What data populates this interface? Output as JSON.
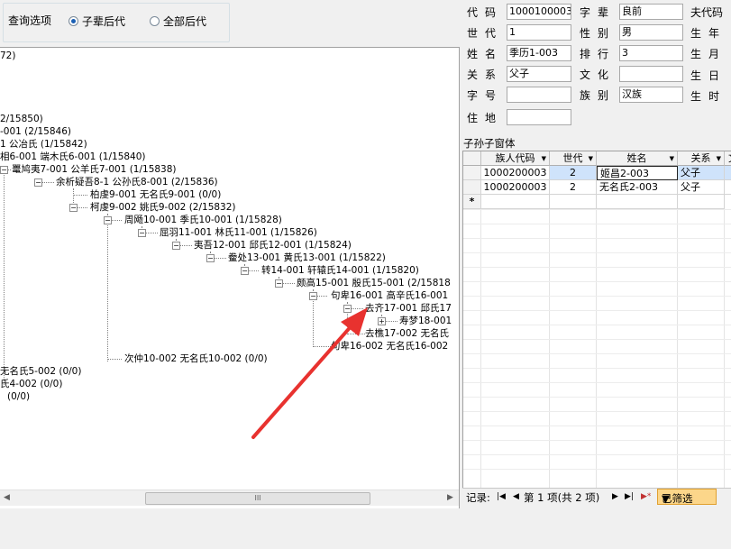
{
  "query_options": {
    "title": "查询选项",
    "radios": [
      {
        "label": "子辈后代",
        "checked": true
      },
      {
        "label": "全部后代",
        "checked": false
      }
    ]
  },
  "tree": {
    "lines": [
      "72)",
      "2/15850)",
      "-001  (2/15846)",
      "1  公冶氏  (1/15842)",
      "相6-001  端木氏6-001  (1/15840)",
      "鼍鸠夷7-001  公羊氏7-001  (1/15838)",
      "余析疑吾8-1  公孙氏8-001  (2/15836)",
      "柏虔9-001  无名氏9-001  (0/0)",
      "柯虔9-002  姚氏9-002  (2/15832)",
      "周飏10-001  季氏10-001  (1/15828)",
      "屈羽11-001  林氏11-001  (1/15826)",
      "夷吾12-001  邱氏12-001  (1/15824)",
      "鲞处13-001  黄氏13-001  (1/15822)",
      "转14-001  轩辕氏14-001  (1/15820)",
      "颇高15-001  殷氏15-001  (2/15818",
      "句卑16-001  高辛氏16-001",
      "去齐17-001  邱氏17",
      "寿梦18-001",
      "去樵17-002  无名氏",
      "句卑16-002  无名氏16-002",
      "次仲10-002  无名氏10-002  (0/0)",
      "无名氏5-002  (0/0)",
      "氏4-002  (0/0)",
      "(0/0)"
    ]
  },
  "form": {
    "fields": [
      {
        "label": "代码",
        "value": "1000100003"
      },
      {
        "label": "字辈",
        "value": "良前"
      },
      {
        "label": "夫代码",
        "value": ""
      },
      {
        "label": "世代",
        "value": "1"
      },
      {
        "label": "性别",
        "value": "男"
      },
      {
        "label": "生年",
        "value": ""
      },
      {
        "label": "姓名",
        "value": "季历1-003"
      },
      {
        "label": "排行",
        "value": "3"
      },
      {
        "label": "生月",
        "value": ""
      },
      {
        "label": "关系",
        "value": "父子"
      },
      {
        "label": "文化",
        "value": ""
      },
      {
        "label": "生日",
        "value": ""
      },
      {
        "label": "字号",
        "value": ""
      },
      {
        "label": "族别",
        "value": "汉族"
      },
      {
        "label": "生时",
        "value": ""
      },
      {
        "label": "住地",
        "value": ""
      }
    ]
  },
  "grid": {
    "caption": "子孙子窗体",
    "columns": [
      "族人代码",
      "世代",
      "姓名",
      "关系",
      "文"
    ],
    "rows": [
      {
        "code": "1000200003",
        "gen": "2",
        "name": "姬昌2-003",
        "rel": "父子"
      },
      {
        "code": "1000200003",
        "gen": "2",
        "name": "无名氏2-003",
        "rel": "父子"
      }
    ],
    "new_row_marker": "*"
  },
  "navigator": {
    "label": "记录:",
    "position": "第 1 项(共 2 项)",
    "filter": "已筛选"
  },
  "scrollbar": {
    "grip": "III"
  },
  "colors": {
    "selection": "#cfe3fb",
    "filter_bg": "#fcd68a",
    "arrow": "#e8322f"
  }
}
